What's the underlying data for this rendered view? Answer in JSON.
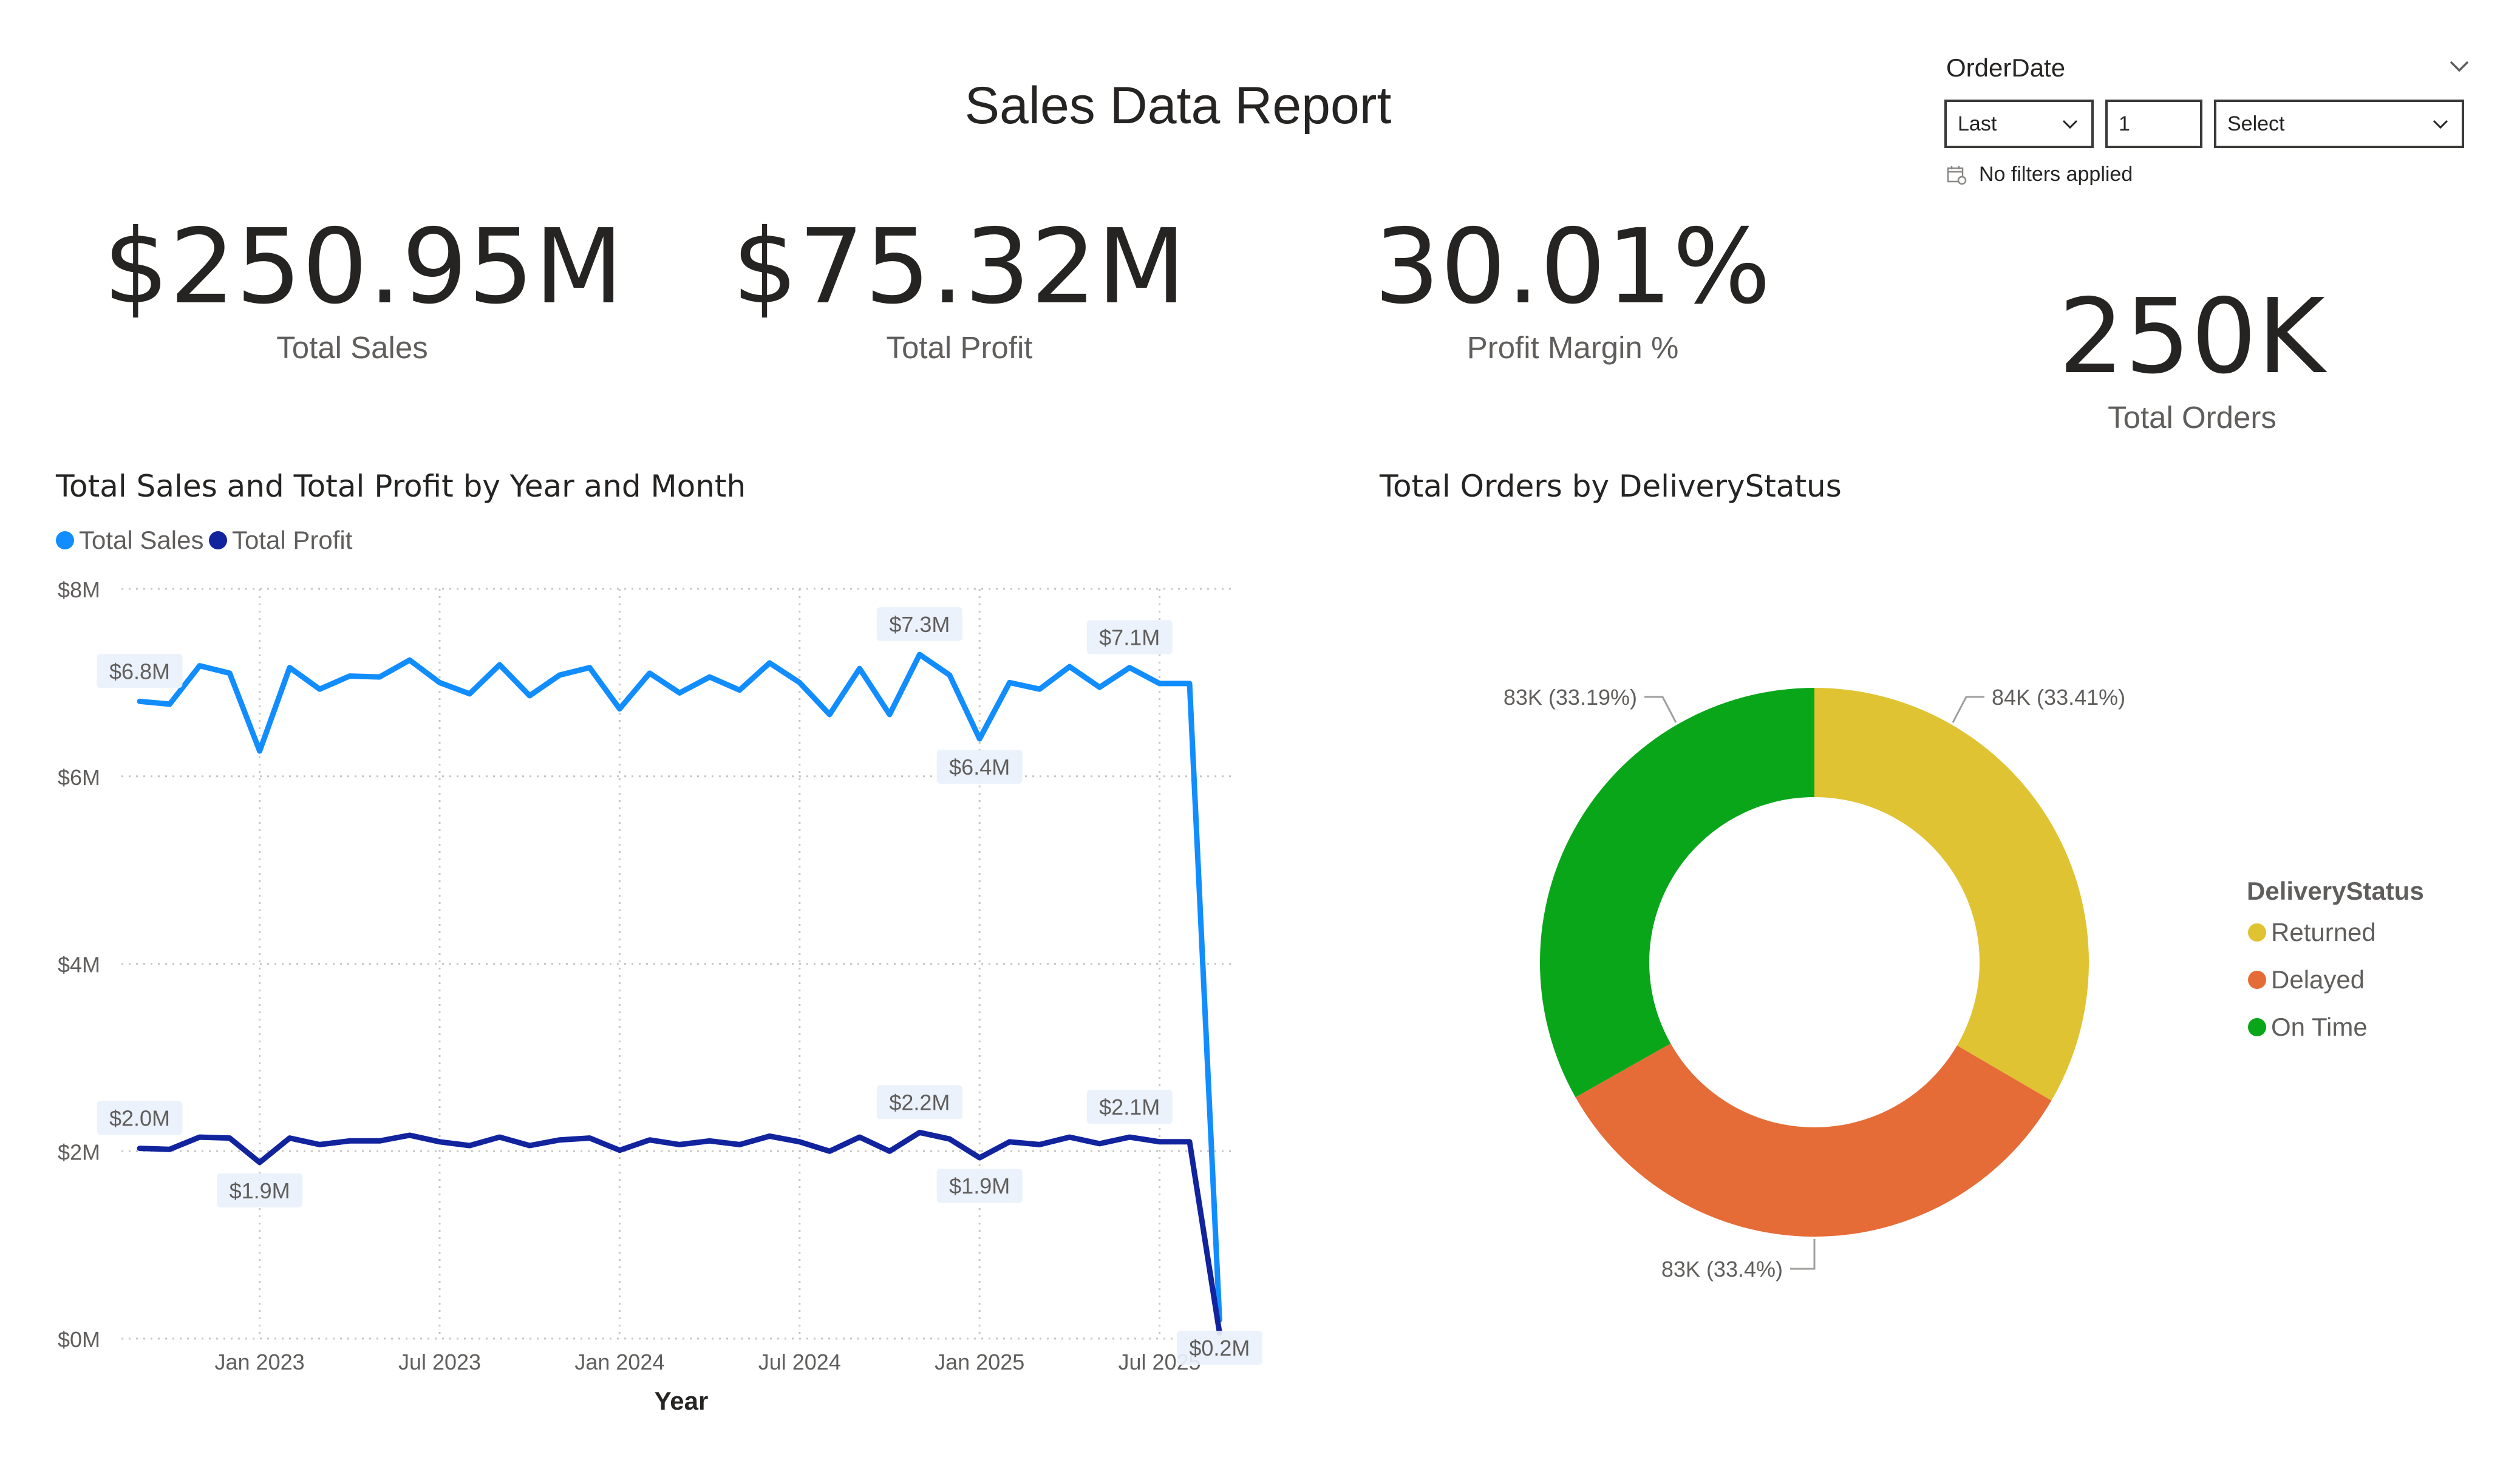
{
  "report": {
    "title": "Sales Data Report"
  },
  "kpis": {
    "total_sales": {
      "value": "$250.95M",
      "label": "Total Sales"
    },
    "total_profit": {
      "value": "$75.32M",
      "label": "Total Profit"
    },
    "profit_margin": {
      "value": "30.01%",
      "label": "Profit Margin %"
    },
    "total_orders": {
      "value": "250K",
      "label": "Total Orders"
    }
  },
  "slicer": {
    "title": "OrderDate",
    "mode": "Last",
    "count": "1",
    "unit": "Select",
    "status": "No filters applied"
  },
  "line_chart": {
    "title": "Total Sales and Total Profit by Year and Month",
    "legend": [
      "Total Sales",
      "Total Profit"
    ]
  },
  "donut_chart": {
    "title": "Total Orders by DeliveryStatus",
    "legend_title": "DeliveryStatus",
    "legend": [
      "Returned",
      "Delayed",
      "On Time"
    ]
  },
  "colors": {
    "total_sales": "#118dff",
    "total_profit": "#12239e",
    "returned": "#e0c332",
    "delayed": "#e66c37",
    "on_time": "#0aa61a"
  },
  "chart_data": [
    {
      "type": "line",
      "title": "Total Sales and Total Profit by Year and Month",
      "xlabel": "Year",
      "ylabel": "",
      "x_ticks": [
        "Jan 2023",
        "Jul 2023",
        "Jan 2024",
        "Jul 2024",
        "Jan 2025",
        "Jul 2025"
      ],
      "y_ticks": [
        "$0M",
        "$2M",
        "$4M",
        "$6M",
        "$8M"
      ],
      "ylim": [
        0,
        8
      ],
      "x": [
        "2022-09",
        "2022-10",
        "2022-11",
        "2022-12",
        "2023-01",
        "2023-02",
        "2023-03",
        "2023-04",
        "2023-05",
        "2023-06",
        "2023-07",
        "2023-08",
        "2023-09",
        "2023-10",
        "2023-11",
        "2023-12",
        "2024-01",
        "2024-02",
        "2024-03",
        "2024-04",
        "2024-05",
        "2024-06",
        "2024-07",
        "2024-08",
        "2024-09",
        "2024-10",
        "2024-11",
        "2024-12",
        "2025-01",
        "2025-02",
        "2025-03",
        "2025-04",
        "2025-05",
        "2025-06",
        "2025-07",
        "2025-08",
        "2025-09",
        "2025-10"
      ],
      "series": [
        {
          "name": "Total Sales",
          "values": [
            6.8,
            6.77,
            7.18,
            7.1,
            6.27,
            7.16,
            6.93,
            7.07,
            7.06,
            7.24,
            7.0,
            6.88,
            7.19,
            6.86,
            7.08,
            7.16,
            6.72,
            7.1,
            6.89,
            7.06,
            6.92,
            7.21,
            7.0,
            6.66,
            7.15,
            6.66,
            7.3,
            7.08,
            6.4,
            7.0,
            6.93,
            7.17,
            6.95,
            7.16,
            6.99,
            6.99,
            0.2
          ],
          "data_labels": [
            {
              "index": 0,
              "text": "$6.8M",
              "pos": "above"
            },
            {
              "index": 26,
              "text": "$7.3M",
              "pos": "above"
            },
            {
              "index": 28,
              "text": "$6.4M",
              "pos": "below"
            },
            {
              "index": 33,
              "text": "$7.1M",
              "pos": "above"
            },
            {
              "index": 36,
              "text": "$0.2M",
              "pos": "below"
            }
          ]
        },
        {
          "name": "Total Profit",
          "values": [
            2.03,
            2.02,
            2.15,
            2.14,
            1.88,
            2.14,
            2.07,
            2.11,
            2.11,
            2.17,
            2.1,
            2.06,
            2.15,
            2.06,
            2.12,
            2.14,
            2.01,
            2.12,
            2.07,
            2.11,
            2.07,
            2.16,
            2.1,
            2.0,
            2.15,
            2.0,
            2.2,
            2.13,
            1.93,
            2.1,
            2.07,
            2.15,
            2.08,
            2.15,
            2.1,
            2.1,
            0.06
          ],
          "data_labels": [
            {
              "index": 0,
              "text": "$2.0M",
              "pos": "above"
            },
            {
              "index": 4,
              "text": "$1.9M",
              "pos": "below"
            },
            {
              "index": 26,
              "text": "$2.2M",
              "pos": "above"
            },
            {
              "index": 28,
              "text": "$1.9M",
              "pos": "below"
            },
            {
              "index": 33,
              "text": "$2.1M",
              "pos": "above"
            }
          ]
        }
      ],
      "grid": true,
      "legend_position": "top-left"
    },
    {
      "type": "pie",
      "donut": true,
      "title": "Total Orders by DeliveryStatus",
      "categories": [
        "Returned",
        "Delayed",
        "On Time"
      ],
      "values": [
        84,
        83,
        83
      ],
      "percent": [
        33.41,
        33.4,
        33.19
      ],
      "labels": [
        "84K (33.41%)",
        "83K (33.4%)",
        "83K (33.19%)"
      ],
      "legend_title": "DeliveryStatus",
      "legend_position": "right"
    }
  ]
}
